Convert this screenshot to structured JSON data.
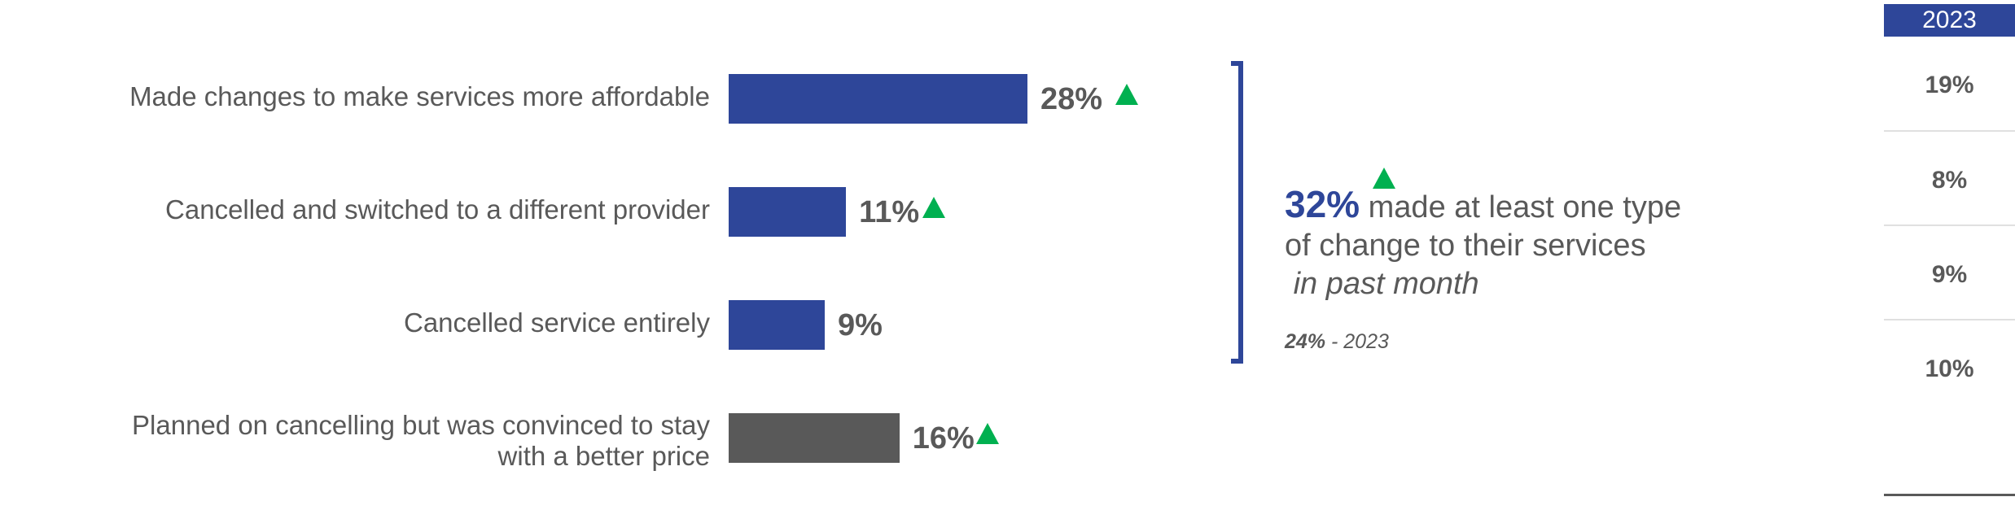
{
  "chart_data": {
    "type": "bar",
    "orientation": "horizontal",
    "title": "",
    "categories": [
      "Made changes to make services more affordable",
      "Cancelled and switched to a different provider",
      "Cancelled service entirely",
      "Planned on cancelling but was convinced to stay with a better price"
    ],
    "values": [
      28,
      11,
      9,
      16
    ],
    "value_labels": [
      "28%",
      "11%",
      "9%",
      "16%"
    ],
    "increase_indicator": [
      true,
      true,
      false,
      true
    ],
    "bar_colors": [
      "#2e4699",
      "#2e4699",
      "#2e4699",
      "#595959"
    ],
    "xlim": [
      0,
      28
    ],
    "comparison_column": {
      "header": "2023",
      "values": [
        "19%",
        "8%",
        "9%",
        "10%"
      ]
    },
    "summary": {
      "value": "32%",
      "increase_indicator": true,
      "line1": "made at least one type",
      "line2": "of change to their services",
      "line3": "in past month",
      "previous_value": "24%",
      "previous_suffix": "- 2023"
    }
  },
  "colors": {
    "accent": "#2e4699",
    "increase": "#00b050",
    "text": "#595959"
  }
}
